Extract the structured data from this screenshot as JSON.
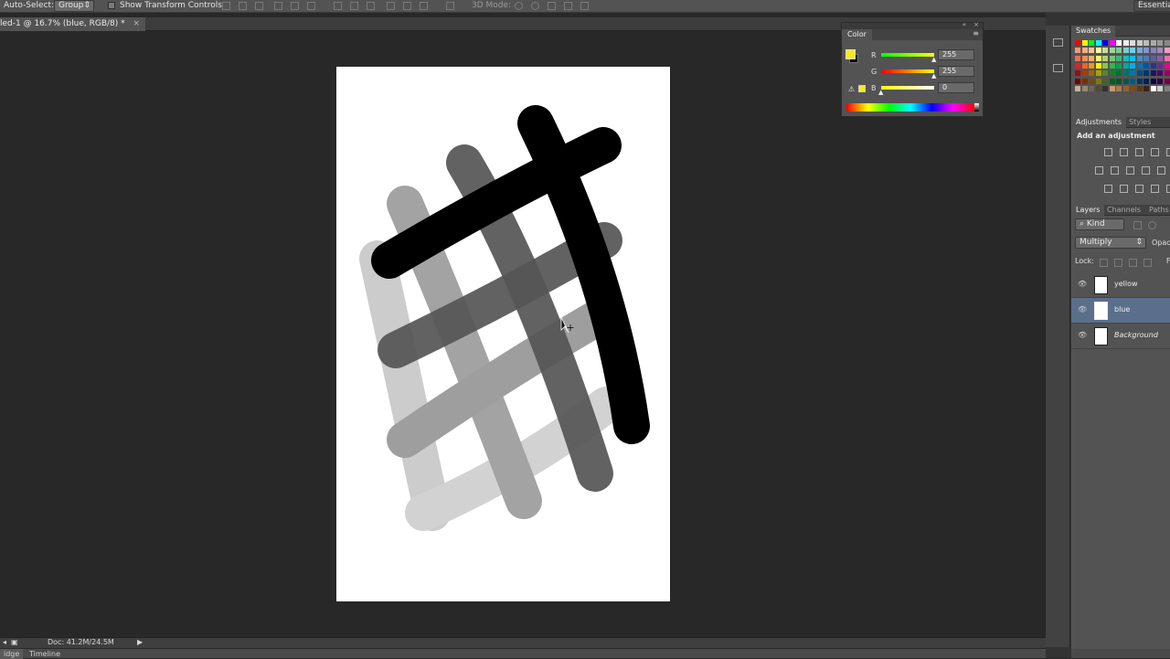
{
  "options_bar": {
    "auto_select_label": "Auto-Select:",
    "auto_select_value": "Group",
    "show_transform_label": "Show Transform Controls",
    "mode_3d_label": "3D Mode:",
    "workspace_label": "Essentials"
  },
  "document": {
    "tab_title": "led-1 @ 16.7% (blue, RGB/8) *",
    "close_glyph": "×",
    "status_doc": "Doc: 41.2M/24.5M"
  },
  "bottom_tabs": [
    "idge",
    "Timeline"
  ],
  "color_panel": {
    "title": "Color",
    "foreground": "#f5ec18",
    "background": "#000000",
    "channels": [
      {
        "label": "R",
        "value": "255"
      },
      {
        "label": "G",
        "value": "255"
      },
      {
        "label": "B",
        "value": "0"
      }
    ]
  },
  "swatches_panel": {
    "title": "Swatches"
  },
  "adjustments_panel": {
    "tabs": [
      "Adjustments",
      "Styles"
    ],
    "heading": "Add an adjustment"
  },
  "layers_panel": {
    "tabs": [
      "Layers",
      "Channels",
      "Paths"
    ],
    "filter_kind": "Kind",
    "blend_mode": "Multiply",
    "opacity_label": "Opac",
    "lock_label": "Lock:",
    "fill_label": "F",
    "layers": [
      {
        "name": "yellow",
        "selected": false
      },
      {
        "name": "blue",
        "selected": true
      },
      {
        "name": "Background",
        "selected": false
      }
    ]
  },
  "colors": {
    "app_bg": "#282828",
    "panel_bg": "#535353",
    "selection": "#5b6f8c"
  }
}
